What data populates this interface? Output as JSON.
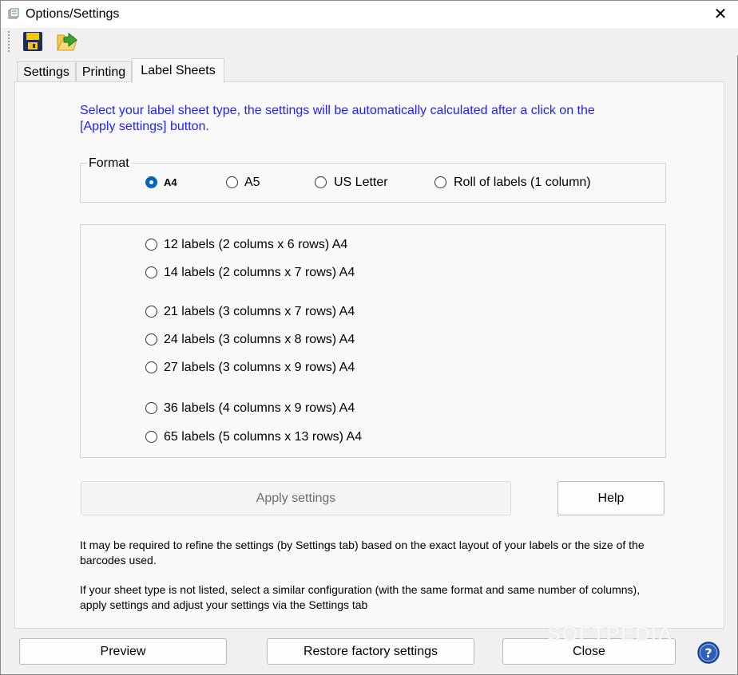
{
  "window": {
    "title": "Options/Settings",
    "close_glyph": "✕"
  },
  "toolbar": {
    "icons": [
      "save-icon",
      "open-folder-arrow-icon"
    ]
  },
  "tabs": [
    {
      "label": "Settings",
      "active": false
    },
    {
      "label": "Printing",
      "active": false
    },
    {
      "label": "Label Sheets",
      "active": true
    }
  ],
  "label_sheets": {
    "intro": "Select your label sheet type, the settings will be automatically calculated after a click on the [Apply settings] button.",
    "intro_color": "#1f1fff",
    "format": {
      "legend": "Format",
      "options": [
        {
          "label": "A4",
          "checked": true
        },
        {
          "label": "A5",
          "checked": false
        },
        {
          "label": "US Letter",
          "checked": false
        },
        {
          "label": "Roll of labels (1 column)",
          "checked": false
        }
      ]
    },
    "sheet_options": [
      {
        "label": "12 labels (2 colums x 6 rows) A4",
        "checked": false
      },
      {
        "label": "14 labels (2 columns x 7 rows) A4",
        "checked": false
      },
      {
        "label": "21 labels (3 columns x 7 rows) A4",
        "checked": false
      },
      {
        "label": "24 labels (3 columns x 8 rows) A4",
        "checked": false
      },
      {
        "label": "27 labels (3 columns x 9 rows) A4",
        "checked": false
      },
      {
        "label": "36 labels (4 columns x 9 rows) A4",
        "checked": false
      },
      {
        "label": "65 labels (5 columns x 13 rows) A4",
        "checked": false
      }
    ],
    "apply_label": "Apply settings",
    "help_label": "Help",
    "note1": "It may be required to refine the settings (by Settings tab) based on the exact layout of your labels or the size of the barcodes used.",
    "note2": "If your sheet type is not listed, select a similar configuration (with the same format and same number of columns), apply settings and adjust your settings via the Settings tab"
  },
  "footer": {
    "preview_label": "Preview",
    "restore_label": "Restore factory settings",
    "close_label": "Close",
    "help_icon": "question-circle-icon"
  },
  "watermark": "SOFTPEDIA",
  "colors": {
    "accent": "#0067c0",
    "help_icon_blue": "#2e5fb8"
  }
}
